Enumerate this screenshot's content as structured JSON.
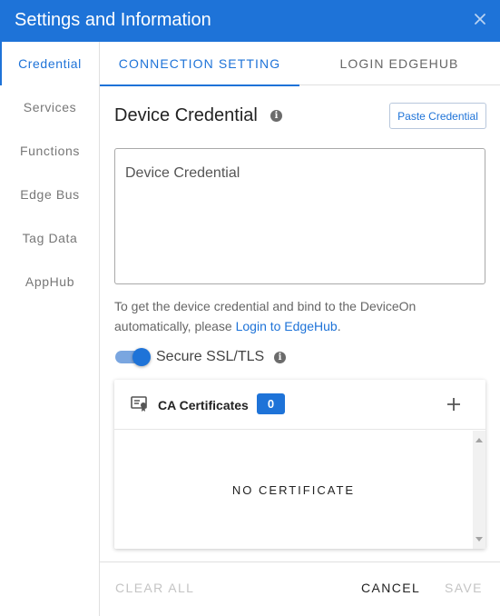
{
  "dialog": {
    "title": "Settings and Information",
    "close_icon": "close-icon"
  },
  "sidebar": {
    "items": [
      {
        "label": "Credential",
        "active": true
      },
      {
        "label": "Services"
      },
      {
        "label": "Functions"
      },
      {
        "label": "Edge Bus"
      },
      {
        "label": "Tag Data"
      },
      {
        "label": "AppHub"
      }
    ]
  },
  "tabs": [
    {
      "label": "CONNECTION SETTING",
      "active": true
    },
    {
      "label": "LOGIN EDGEHUB"
    }
  ],
  "credential": {
    "title": "Device Credential",
    "info_icon": "info-icon",
    "paste_label": "Paste Credential",
    "placeholder": "Device Credential",
    "help_text": "To get the device credential and bind to the DeviceOn automatically, please ",
    "help_link": "Login to EdgeHub",
    "help_end": "."
  },
  "ssl": {
    "label": "Secure SSL/TLS",
    "enabled": true
  },
  "certificates": {
    "title": "CA Certificates",
    "count": "0",
    "empty_text": "NO CERTIFICATE",
    "icon": "certificate-icon",
    "add_icon": "plus-icon"
  },
  "footer": {
    "clear_all": "CLEAR ALL",
    "cancel": "CANCEL",
    "save": "SAVE"
  },
  "colors": {
    "accent": "#1e73d8",
    "disabled": "#c4c4c4"
  }
}
